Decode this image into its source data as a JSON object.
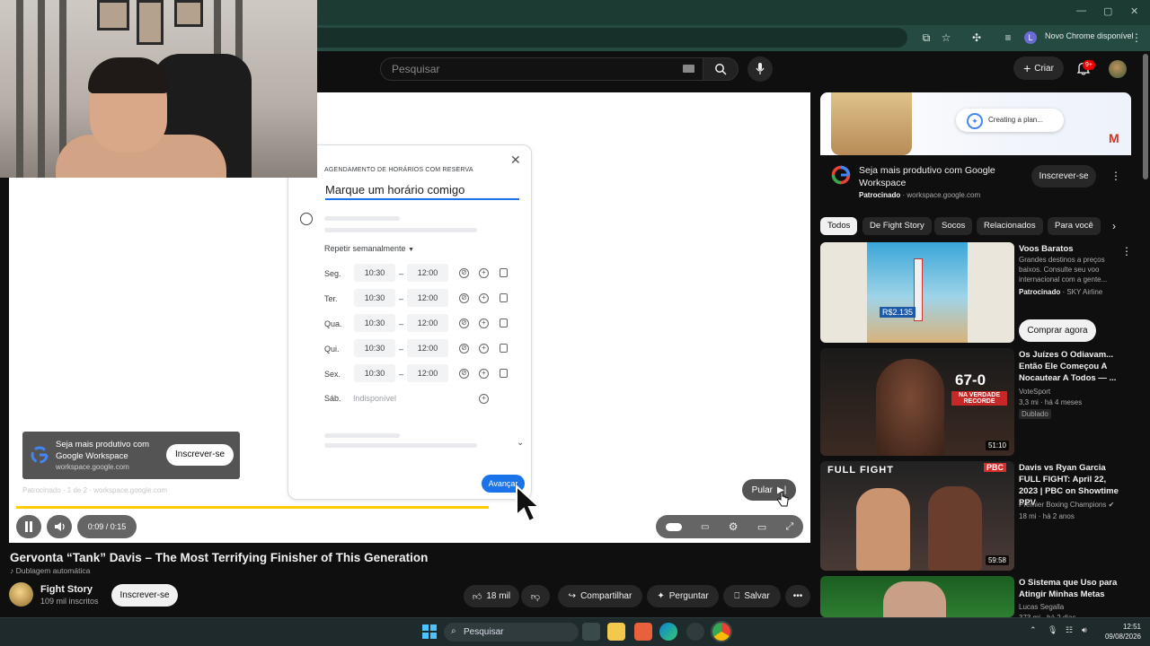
{
  "browser": {
    "new_chrome_label": "Novo Chrome disponível",
    "profile_initial": "L"
  },
  "youtube_header": {
    "search_placeholder": "Pesquisar",
    "create_label": "Criar",
    "notification_badge": "9+"
  },
  "scheduling_form": {
    "heading": "AGENDAMENTO DE HORÁRIOS COM RESERVA",
    "title": "Marque um horário comigo",
    "repeat_label": "Repetir semanalmente",
    "days": [
      {
        "label": "Seg.",
        "start": "10:30",
        "end": "12:00"
      },
      {
        "label": "Ter.",
        "start": "10:30",
        "end": "12:00"
      },
      {
        "label": "Qua.",
        "start": "10:30",
        "end": "12:00"
      },
      {
        "label": "Qui.",
        "start": "10:30",
        "end": "12:00"
      },
      {
        "label": "Sex.",
        "start": "10:30",
        "end": "12:00"
      }
    ],
    "sat_label": "Sáb.",
    "sat_value": "Indisponível",
    "next_button": "Avançar"
  },
  "player": {
    "ad_overlay": {
      "title": "Seja mais produtivo com Google Workspace",
      "url": "workspace.google.com",
      "subscribe": "Inscrever-se"
    },
    "ad_meta": "Patrocinado · 1 de 2 · workspace.google.com",
    "skip_label": "Pular",
    "time": "0:09 / 0:15",
    "progress_fraction": 0.6
  },
  "video": {
    "title": "Gervonta “Tank” Davis – The Most Terrifying Finisher of This Generation",
    "dubbing": "Dublagem automática",
    "channel": "Fight Story",
    "subscribers": "109 mil inscritos",
    "subscribe": "Inscrever-se",
    "likes": "18 mil",
    "share": "Compartilhar",
    "ask": "Perguntar",
    "save": "Salvar"
  },
  "sidebar_ad": {
    "banner_text": "Creating a plan...",
    "title": "Seja mais produtivo com Google Workspace",
    "sponsored": "Patrocinado",
    "domain": "workspace.google.com",
    "subscribe": "Inscrever-se"
  },
  "chips": [
    "Todos",
    "De Fight Story",
    "Socos",
    "Relacionados",
    "Para você"
  ],
  "recommendations": [
    {
      "title": "Voos Baratos",
      "desc": "Grandes destinos a preços baixos. Consulte seu voo internacional com a gente...",
      "sponsored": "Patrocinado",
      "advertiser": "SKY Airline",
      "cta": "Comprar agora",
      "thumb_price": "R$2.135"
    },
    {
      "title": "Os Juízes O Odiavam... Então Ele Começou A Nocautear A Todos — ...",
      "channel": "VoteSport",
      "stats": "3,3 mi · há 4 meses",
      "badge": "Dublado",
      "duration": "51:10",
      "thumb_text_1": "67-0",
      "thumb_text_2": "NA VERDADE RECORDE"
    },
    {
      "title": "Davis vs Ryan Garcia FULL FIGHT: April 22, 2023 | PBC on Showtime PPV",
      "channel": "Premier Boxing Champions",
      "stats": "18 mi · há 2 anos",
      "duration": "59:58",
      "thumb_text_1": "FULL FIGHT",
      "thumb_text_2": "PBC"
    },
    {
      "title": "O Sistema que Uso para Atingir Minhas Metas",
      "channel": "Lucas Segalla",
      "stats": "373 mi · há 2 dias"
    }
  ],
  "taskbar": {
    "search": "Pesquisar",
    "time": "12:51",
    "date": "09/08/2026"
  },
  "colors": {
    "chrome_tabbar": "#1b3b33",
    "chrome_toolbar": "#244a41",
    "youtube_bg": "#0f0f0f",
    "progress": "#ffcc00",
    "accent_blue": "#1a73e8"
  }
}
